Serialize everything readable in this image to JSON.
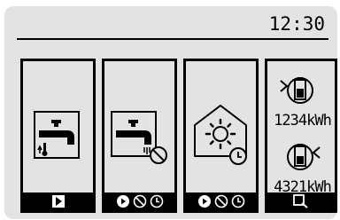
{
  "status_bar": {
    "time": "12:30"
  },
  "menu": [
    {
      "id": "hot_water",
      "icons": [
        "tap-icon",
        "thermometer-icon"
      ],
      "footer": [
        "play-icon"
      ]
    },
    {
      "id": "legionella",
      "icons": [
        "tap-icon",
        "prohibit-icon"
      ],
      "footer": [
        "power-icon",
        "prohibit-icon",
        "timer-icon"
      ]
    },
    {
      "id": "heating",
      "icons": [
        "house-sun-icon",
        "timer-icon"
      ],
      "footer": [
        "power-icon",
        "prohibit-icon",
        "timer-icon"
      ]
    },
    {
      "id": "energy",
      "icons": [
        "energy-in-icon",
        "energy-out-icon"
      ],
      "footer": [
        "magnifier-icon"
      ],
      "consumed": "1234kWh",
      "delivered": "4321kWh"
    }
  ]
}
